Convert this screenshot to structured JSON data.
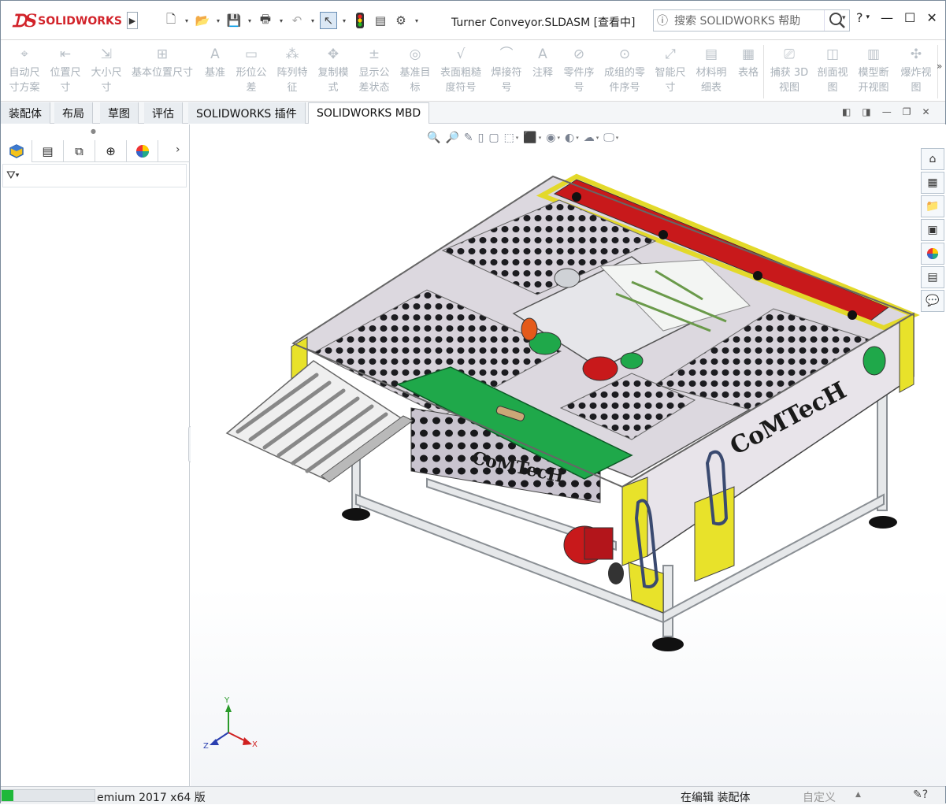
{
  "titlebar": {
    "brand": "SOLIDWORKS",
    "document_title": "Turner Conveyor.SLDASM [查看中]",
    "search_placeholder": "搜索 SOLIDWORKS 帮助",
    "help_label": "?"
  },
  "quick_access": [
    "new-icon",
    "open-icon",
    "save-icon",
    "print-icon",
    "undo-icon",
    "select-icon",
    "rebuild-icon",
    "file-properties-icon",
    "options-icon"
  ],
  "command_manager": {
    "items": [
      {
        "label": "自动尺\n寸方案",
        "icon": "auto-dimension-icon"
      },
      {
        "label": "位置尺\n寸",
        "icon": "location-dimension-icon"
      },
      {
        "label": "大小尺\n寸",
        "icon": "size-dimension-icon"
      },
      {
        "label": "基本位置尺寸",
        "icon": "basic-location-dimension-icon"
      },
      {
        "label": "基准",
        "icon": "datum-icon"
      },
      {
        "label": "形位公\n差",
        "icon": "geometric-tolerance-icon"
      },
      {
        "label": "阵列特\n征",
        "icon": "pattern-feature-icon"
      },
      {
        "label": "复制模\n式",
        "icon": "copy-scheme-icon"
      },
      {
        "label": "显示公\n差状态",
        "icon": "show-tolerance-status-icon"
      },
      {
        "label": "基准目\n标",
        "icon": "datum-target-icon"
      },
      {
        "label": "表面粗糙\n度符号",
        "icon": "surface-finish-icon"
      },
      {
        "label": "焊接符\n号",
        "icon": "weld-symbol-icon"
      },
      {
        "label": "注释",
        "icon": "note-icon"
      },
      {
        "label": "零件序\n号",
        "icon": "balloon-icon"
      },
      {
        "label": "成组的零\n件序号",
        "icon": "stacked-balloon-icon"
      },
      {
        "label": "智能尺\n寸",
        "icon": "smart-dimension-icon"
      },
      {
        "label": "材料明\n细表",
        "icon": "bom-icon"
      },
      {
        "label": "表格",
        "icon": "table-icon"
      },
      {
        "label": "捕获 3D\n视图",
        "icon": "capture-3d-view-icon"
      },
      {
        "label": "剖面视\n图",
        "icon": "section-view-icon"
      },
      {
        "label": "模型断\n开视图",
        "icon": "model-break-view-icon"
      },
      {
        "label": "爆炸视\n图",
        "icon": "exploded-view-icon"
      }
    ]
  },
  "tabs": [
    {
      "label": "装配体",
      "active": false
    },
    {
      "label": "布局",
      "active": false
    },
    {
      "label": "草图",
      "active": false
    },
    {
      "label": "评估",
      "active": false
    },
    {
      "label": "SOLIDWORKS 插件",
      "active": false
    },
    {
      "label": "SOLIDWORKS MBD",
      "active": true
    }
  ],
  "left_panel": {
    "tabs": [
      "featuremanager-icon",
      "propertymanager-icon",
      "configurationmanager-icon",
      "dimxpert-icon",
      "displaymanager-icon"
    ]
  },
  "heads_up_toolbar": [
    "zoom-to-fit-icon",
    "zoom-to-area-icon",
    "previous-view-icon",
    "section-view-icon",
    "dynamic-annotation-icon",
    "view-orientation-icon",
    "display-style-icon",
    "hide-show-items-icon",
    "edit-appearance-icon",
    "apply-scene-icon",
    "view-settings-icon"
  ],
  "task_pane": [
    "solidworks-resources-icon",
    "design-library-icon",
    "file-explorer-icon",
    "view-palette-icon",
    "appearances-icon",
    "custom-properties-icon",
    "forum-icon"
  ],
  "model": {
    "logo_text": "CoMTecH"
  },
  "triad": {
    "x": "X",
    "y": "Y",
    "z": "Z"
  },
  "statusbar": {
    "product": "emium 2017 x64 版",
    "mode": "在编辑 装配体",
    "units": "自定义",
    "progress": 0.13
  },
  "colors": {
    "brand": "#d2232a",
    "accent_green": "#1fa84a",
    "rail_red": "#c8191b",
    "rail_yellow": "#e8e22a"
  }
}
